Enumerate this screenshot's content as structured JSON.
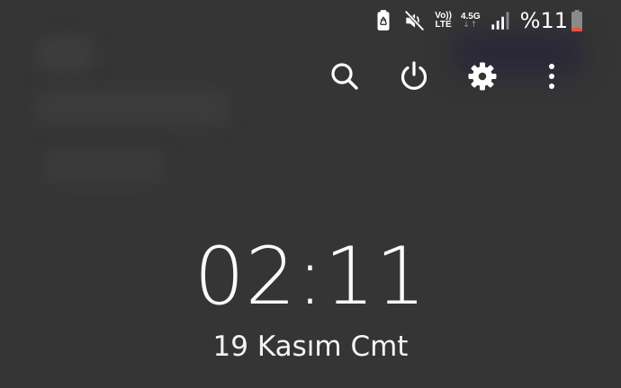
{
  "status_bar": {
    "volte_top": "Vo))",
    "volte_bottom": "LTE",
    "network_type": "4.5G",
    "network_arrows": "↓↑",
    "battery_percent": "%11",
    "icons": [
      "recycle-battery-icon",
      "mute-icon",
      "volte-icon",
      "network-45g-icon",
      "signal-icon",
      "battery-icon"
    ],
    "battery_level": 0.11,
    "battery_low_color": "#e8553e"
  },
  "toolbar": {
    "icons": [
      "search-icon",
      "power-icon",
      "settings-gear-icon",
      "more-options-icon"
    ]
  },
  "clock": {
    "time": "02:11",
    "date": "19 Kasım Cmt"
  },
  "colors": {
    "background": "#353535",
    "foreground": "#ffffff"
  }
}
